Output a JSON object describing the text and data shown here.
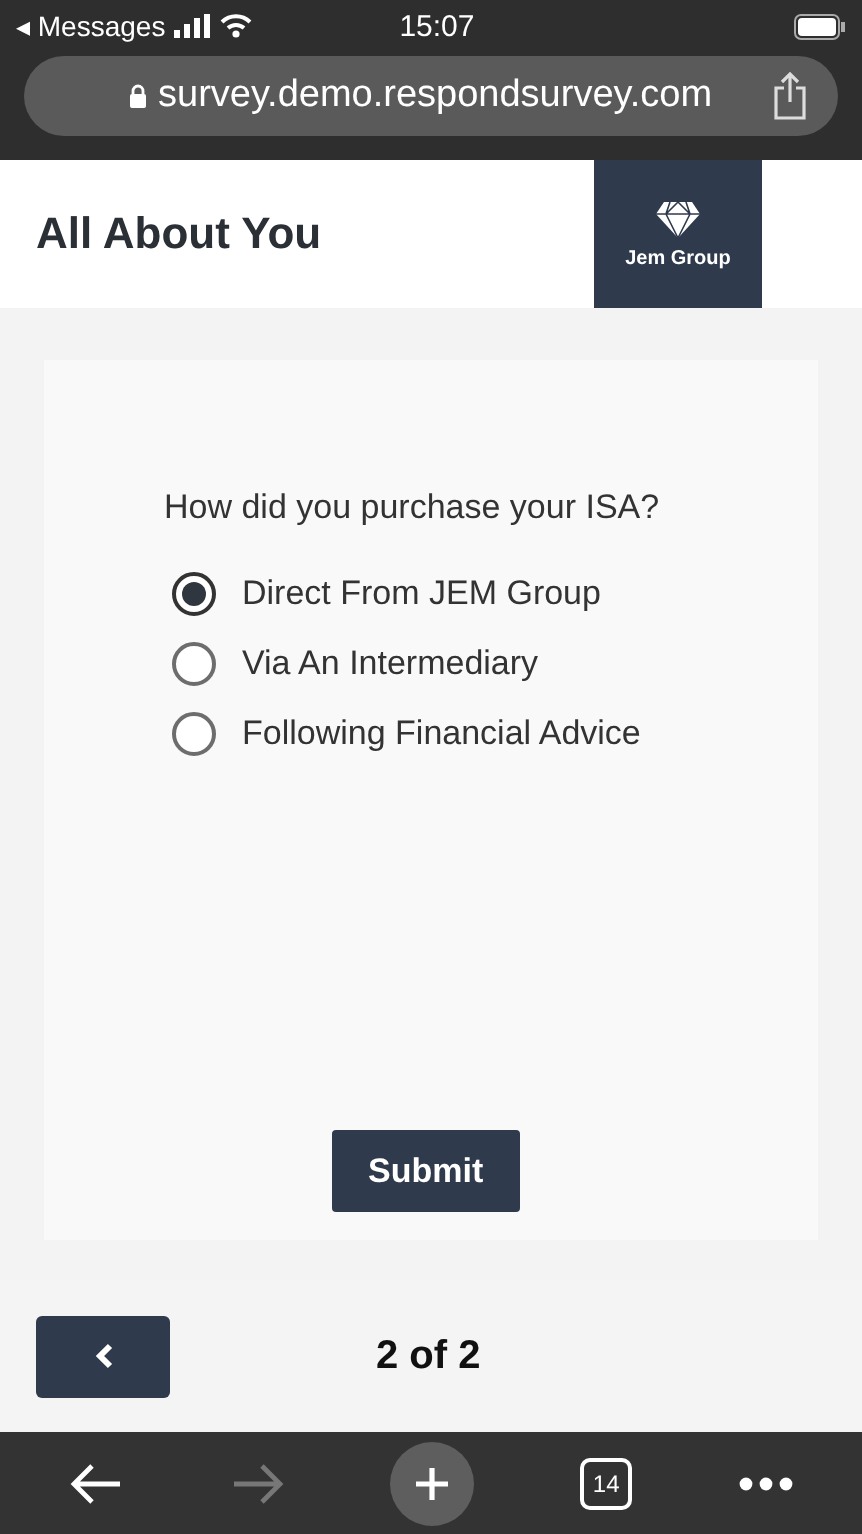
{
  "status_bar": {
    "back_label": "◂ Messages",
    "time": "15:07"
  },
  "address_bar": {
    "url": "survey.demo.respondsurvey.com"
  },
  "header": {
    "title": "All About You",
    "logo_text": "Jem Group"
  },
  "question": {
    "text": "How did you purchase your ISA?",
    "options": [
      {
        "label": "Direct From JEM Group",
        "selected": true
      },
      {
        "label": "Via An Intermediary",
        "selected": false
      },
      {
        "label": "Following Financial Advice",
        "selected": false
      }
    ]
  },
  "submit_label": "Submit",
  "pager": {
    "text": "2 of 2"
  },
  "toolbar": {
    "tabs_count": "14",
    "forward_disabled": true
  }
}
